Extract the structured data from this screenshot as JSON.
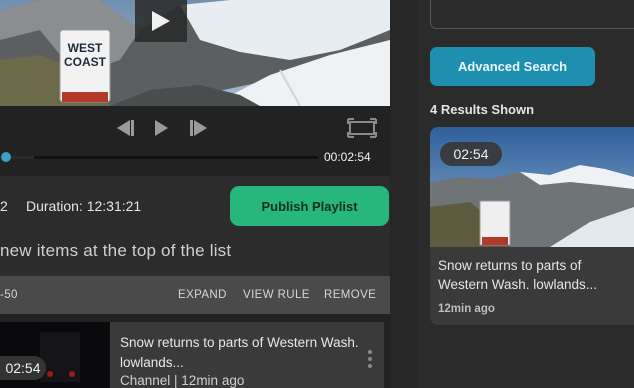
{
  "player": {
    "time": "00:02:54",
    "progress_fraction": 0.01,
    "truck_sign_line1": "WEST",
    "truck_sign_line2": "COAST"
  },
  "playlist": {
    "count_fragment": "2",
    "duration": "Duration: 12:31:21",
    "publish_label": "Publish Playlist",
    "hint": "new items at the top of the list",
    "header_left": "-50",
    "actions": {
      "expand": "EXPAND",
      "view_rule": "VIEW RULE",
      "remove": "REMOVE"
    },
    "item": {
      "badge": "02:54",
      "title": "Snow returns to parts of Western Wash. lowlands...",
      "subtitle": "Channel | 12min ago"
    }
  },
  "search": {
    "advanced_label": "Advanced Search",
    "results_label": "4 Results Shown",
    "card": {
      "badge": "02:54",
      "title": "Snow returns to parts of Western Wash. lowlands...",
      "age": "12min ago"
    }
  },
  "colors": {
    "publish": "#27b67c",
    "advanced": "#1f8fb0",
    "progress": "#3aa0c8"
  }
}
